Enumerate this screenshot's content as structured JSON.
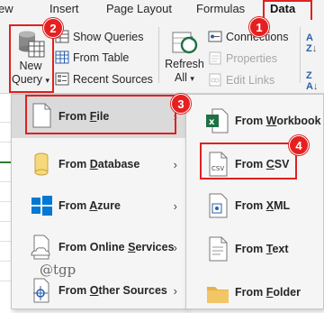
{
  "tabs": [
    {
      "label": "ew"
    },
    {
      "label": "Insert"
    },
    {
      "label": "Page Layout"
    },
    {
      "label": "Formulas"
    },
    {
      "label": "Data"
    }
  ],
  "ribbon": {
    "new_query_line1": "New",
    "new_query_line2": "Query",
    "show_queries": "Show Queries",
    "from_table": "From Table",
    "recent_sources": "Recent Sources",
    "refresh_line1": "Refresh",
    "refresh_line2": "All",
    "connections": "Connections",
    "properties": "Properties",
    "edit_links": "Edit Links"
  },
  "badges": [
    "1",
    "2",
    "3",
    "4"
  ],
  "menu_primary": [
    {
      "pre": "From ",
      "u": "F",
      "post": "ile"
    },
    {
      "pre": "From ",
      "u": "D",
      "post": "atabase"
    },
    {
      "pre": "From ",
      "u": "A",
      "post": "zure"
    },
    {
      "pre": "From Online ",
      "u": "S",
      "post": "ervices"
    },
    {
      "pre": "From ",
      "u": "O",
      "post": "ther Sources"
    }
  ],
  "menu_file": [
    {
      "pre": "From ",
      "u": "W",
      "post": "orkbook"
    },
    {
      "pre": "From ",
      "u": "C",
      "post": "SV"
    },
    {
      "pre": "From ",
      "u": "X",
      "post": "ML"
    },
    {
      "pre": "From ",
      "u": "T",
      "post": "ext"
    },
    {
      "pre": "From ",
      "u": "F",
      "post": "older"
    }
  ],
  "icons": {
    "csv_text": "CSV"
  },
  "watermark": "@tgp",
  "colors": {
    "highlight": "#e02020",
    "excel_green": "#1e7145",
    "azure_blue": "#0078d4",
    "folder": "#e8b24a"
  }
}
